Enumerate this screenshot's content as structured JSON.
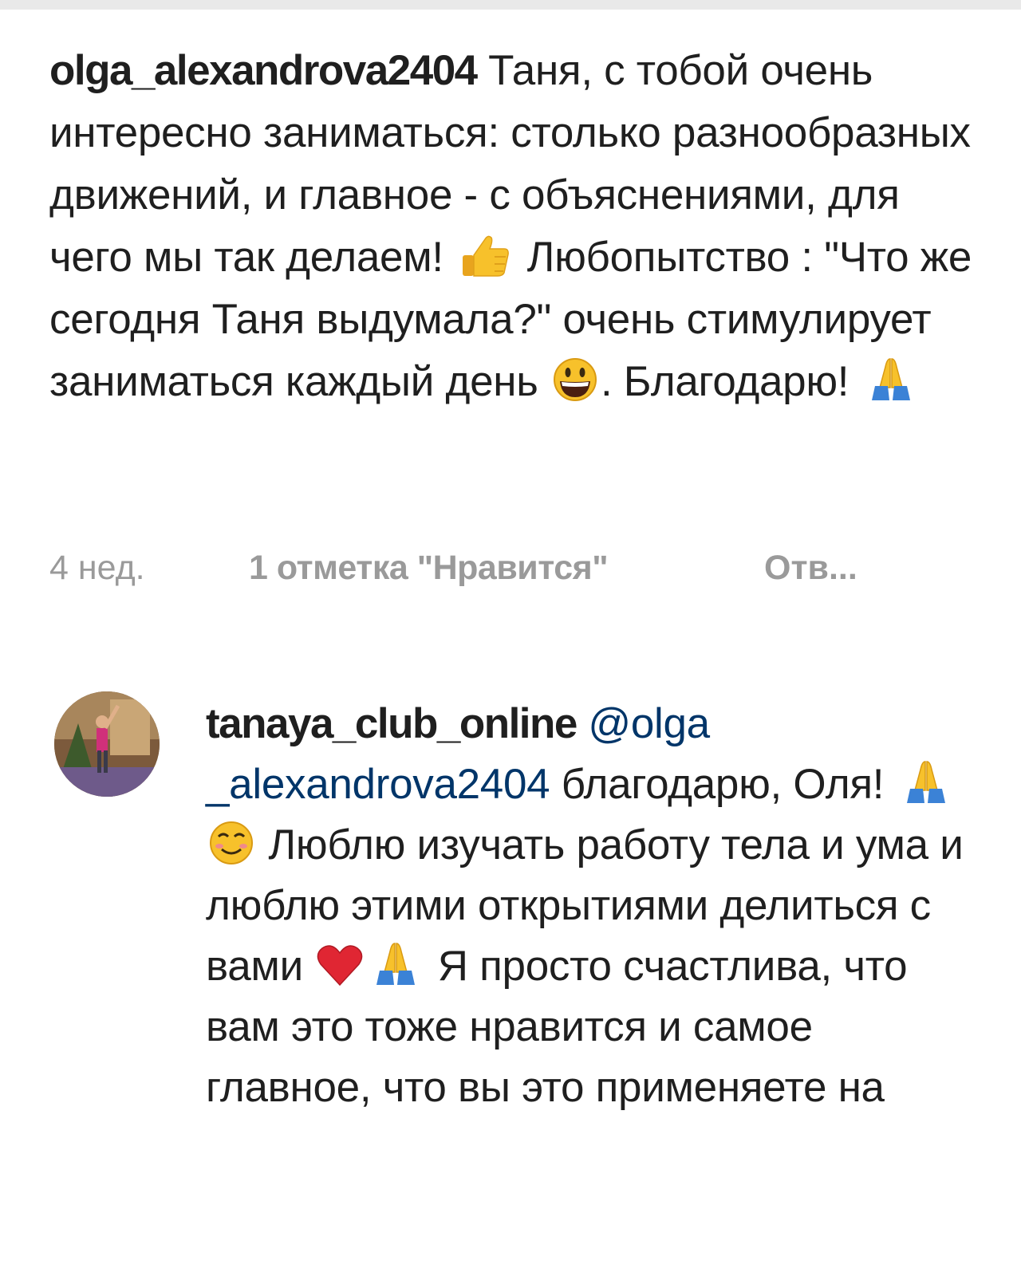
{
  "comment": {
    "username": "olga_alexandrova2404",
    "text_1": " Таня, с тобой очень интересно заниматься: столько разнообразных движений, и главное - с объяснениями, для чего мы так делаем! ",
    "emoji_1": "thumbs-up",
    "text_2": " Любопытство : \"Что же сегодня Таня выдумала?\" очень стимулирует заниматься каждый день ",
    "emoji_2": "grinning-face",
    "text_3": ". Благодарю! ",
    "emoji_3": "folded-hands",
    "time": "4 нед.",
    "likes": "1 отметка \"Нравится\"",
    "reply": "Отв..."
  },
  "reply": {
    "username": "tanaya_club_online",
    "mention": "@olga _alexandrova2404",
    "text_1": " благодарю, Оля! ",
    "emoji_1": "folded-hands",
    "emoji_2": "smiling-face",
    "text_2": " Люблю изучать работу тела и ума и люблю этими открытиями делиться с вами ",
    "emoji_3": "red-heart",
    "emoji_4": "folded-hands",
    "text_3": " Я просто счастлива, что вам это тоже нравится и самое главное, что вы  это применяете на"
  },
  "colors": {
    "text": "#1f1f1f",
    "meta": "#9a9a9a",
    "mention": "#003569",
    "emoji_yellow": "#f7c12b",
    "heart": "#e02633",
    "sleeve": "#3b82d6"
  }
}
